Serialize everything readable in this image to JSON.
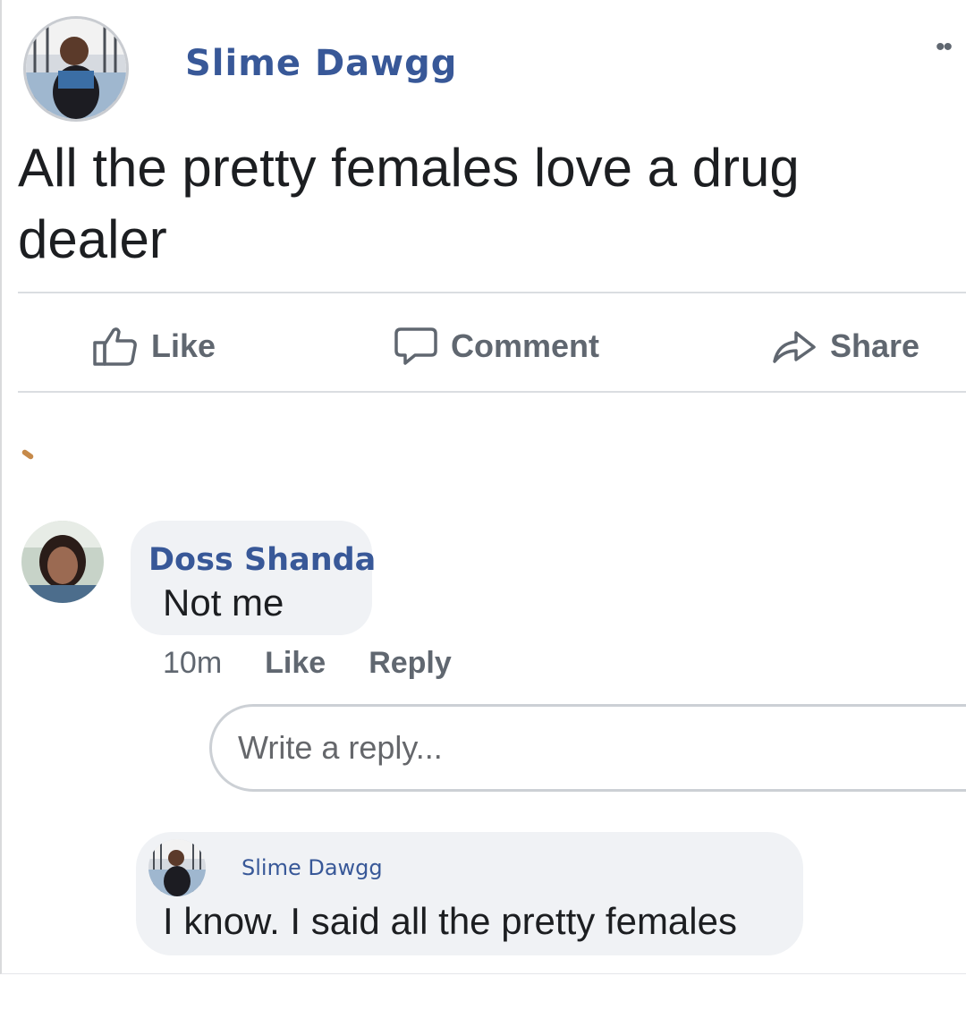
{
  "post": {
    "author": "Slime Dawgg",
    "text": "All the pretty females love a drug dealer",
    "more_icon": "more-dots-icon"
  },
  "actions": {
    "like_label": "Like",
    "comment_label": "Comment",
    "share_label": "Share"
  },
  "comment": {
    "author": "Doss Shanda",
    "text": "Not me",
    "time": "10m",
    "like_label": "Like",
    "reply_label": "Reply"
  },
  "reply_input": {
    "placeholder": "Write a reply..."
  },
  "reply": {
    "author": "Slime Dawgg",
    "text": "I know. I said all the pretty females"
  },
  "colors": {
    "name_blue": "#385898",
    "text": "#1c1e21",
    "muted": "#606770",
    "bubble": "#f0f2f5"
  }
}
